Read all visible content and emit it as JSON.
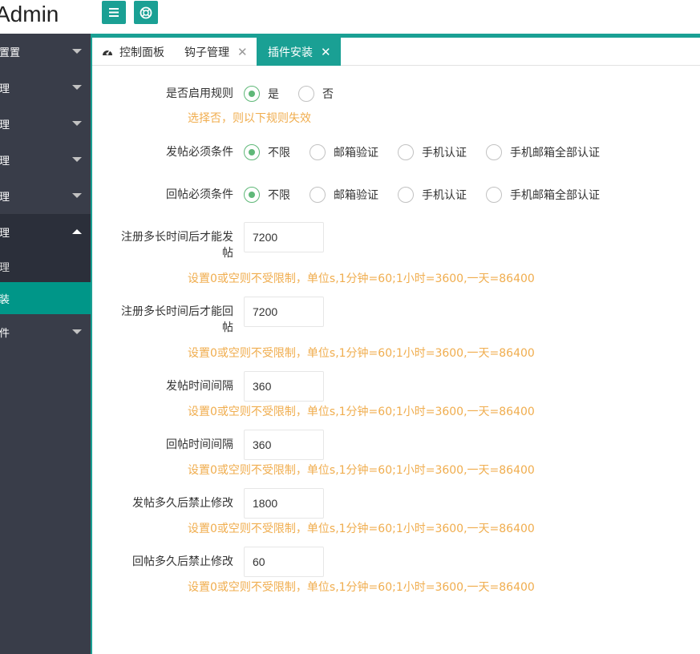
{
  "header": {
    "logo": "Admin",
    "menu_icon": "hamburger-icon",
    "help_icon": "lifebuoy-icon",
    "accent": "#1aa094"
  },
  "sidebar": {
    "items": [
      {
        "label": "设置置"
      },
      {
        "label": "管理"
      },
      {
        "label": "管理"
      },
      {
        "label": "管理"
      },
      {
        "label": "管理"
      },
      {
        "label": "管理"
      }
    ],
    "sub_items": [
      {
        "label": "管理"
      },
      {
        "label": "安装"
      }
    ],
    "last_item": {
      "label": "插件"
    },
    "bg": "#393d49",
    "active": "#009688"
  },
  "tabs": [
    {
      "label": "控制面板",
      "icon": "dashboard-icon"
    },
    {
      "label": "钩子管理",
      "close": "✕"
    },
    {
      "label": "插件安装",
      "close": "✕"
    }
  ],
  "form": {
    "enable_rule": {
      "label": "是否启用规则",
      "options": [
        "是",
        "否"
      ],
      "selected": "是",
      "hint": "选择否，则以下规则失效"
    },
    "post_condition": {
      "label": "发帖必须条件",
      "options": [
        "不限",
        "邮箱验证",
        "手机认证",
        "手机邮箱全部认证"
      ],
      "selected": "不限"
    },
    "reply_condition": {
      "label": "回帖必须条件",
      "options": [
        "不限",
        "邮箱验证",
        "手机认证",
        "手机邮箱全部认证"
      ],
      "selected": "不限"
    },
    "reg_post": {
      "label_line1": "注册多长时间后才能发",
      "label_line2": "帖",
      "value": "7200"
    },
    "reg_reply": {
      "label_line1": "注册多长时间后才能回",
      "label_line2": "帖",
      "value": "7200"
    },
    "post_interval": {
      "label": "发帖时间间隔",
      "value": "360"
    },
    "reply_interval": {
      "label": "回帖时间间隔",
      "value": "360"
    },
    "post_edit_lock": {
      "label": "发帖多久后禁止修改",
      "value": "1800"
    },
    "reply_edit_lock": {
      "label": "回帖多久后禁止修改",
      "value": "60"
    },
    "time_hint": "设置0或空则不受限制，单位s,1分钟=60;1小时=3600,一天=86400"
  }
}
